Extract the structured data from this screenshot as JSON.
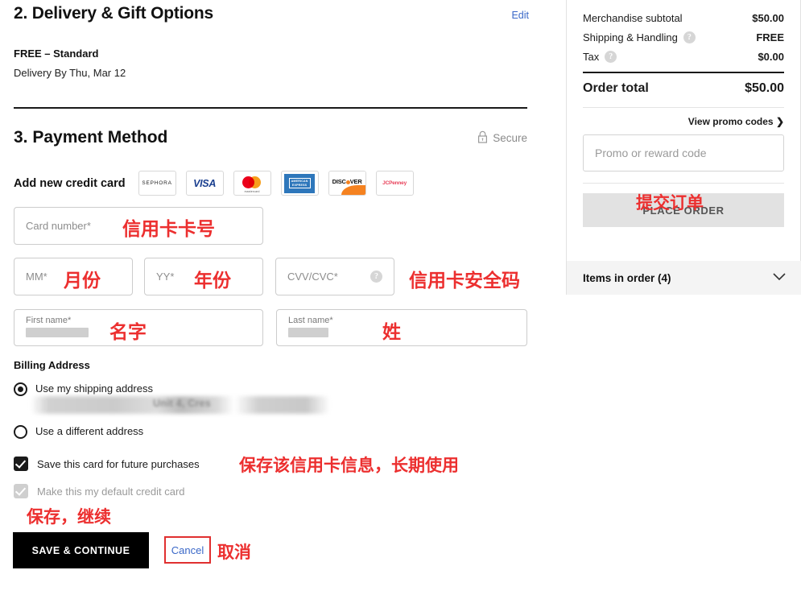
{
  "delivery": {
    "section_title": "2. Delivery & Gift Options",
    "edit_label": "Edit",
    "method": "FREE – Standard",
    "date": "Delivery By Thu, Mar 12"
  },
  "payment": {
    "section_title": "3. Payment Method",
    "secure_label": "Secure",
    "secure_icon": "lock-icon",
    "add_card_label": "Add new credit card",
    "card_logos": [
      {
        "name": "sephora-card-logo",
        "text": "SEPHORA"
      },
      {
        "name": "visa-card-logo",
        "text": "VISA"
      },
      {
        "name": "mastercard-card-logo",
        "text": "mastercard"
      },
      {
        "name": "amex-card-logo",
        "line1": "AMERICAN",
        "line2": "EXPRESS"
      },
      {
        "name": "discover-card-logo",
        "text": "DISC VER"
      },
      {
        "name": "jcpenney-card-logo",
        "text": "JCPenney"
      }
    ],
    "fields": {
      "card_number_placeholder": "Card number*",
      "month_placeholder": "MM*",
      "year_placeholder": "YY*",
      "cvv_placeholder": "CVV/CVC*",
      "cvv_help_icon": "question-mark-icon",
      "first_name_label": "First name*",
      "last_name_label": "Last name*",
      "first_name_value": "",
      "last_name_value": ""
    },
    "billing": {
      "heading": "Billing Address",
      "option_shipping": "Use my shipping address",
      "option_different": "Use a different address",
      "selected": "shipping",
      "address_text": ""
    },
    "checkboxes": [
      {
        "label": "Save this card for future purchases",
        "checked": true,
        "disabled": false
      },
      {
        "label": "Make this my default credit card",
        "checked": true,
        "disabled": true
      }
    ],
    "save_button": "SAVE & CONTINUE",
    "cancel_button": "Cancel"
  },
  "annotations": {
    "card_number": "信用卡卡号",
    "month": "月份",
    "year": "年份",
    "cvv": "信用卡安全码",
    "first_name": "名字",
    "last_name": "姓",
    "save_card": "保存该信用卡信息，长期使用",
    "save_continue": "保存，继续",
    "cancel": "取消",
    "place_order": "提交订单"
  },
  "summary": {
    "rows": [
      {
        "label": "Merchandise subtotal",
        "value": "$50.00",
        "help": false
      },
      {
        "label": "Shipping & Handling",
        "value": "FREE",
        "help": true
      },
      {
        "label": "Tax",
        "value": "$0.00",
        "help": true
      }
    ],
    "total_label": "Order total",
    "total_value": "$50.00",
    "promo_link": "View promo codes",
    "promo_chevron": "❯",
    "promo_placeholder": "Promo or reward code",
    "place_order_label": "PLACE ORDER",
    "items_label": "Items in order (4)",
    "items_chevron_icon": "chevron-down-icon"
  },
  "colors": {
    "accent_link": "#3a68c8",
    "annotation_red": "#ec2f2f",
    "button_black": "#000000",
    "place_order_gray": "#e2e2e2"
  }
}
